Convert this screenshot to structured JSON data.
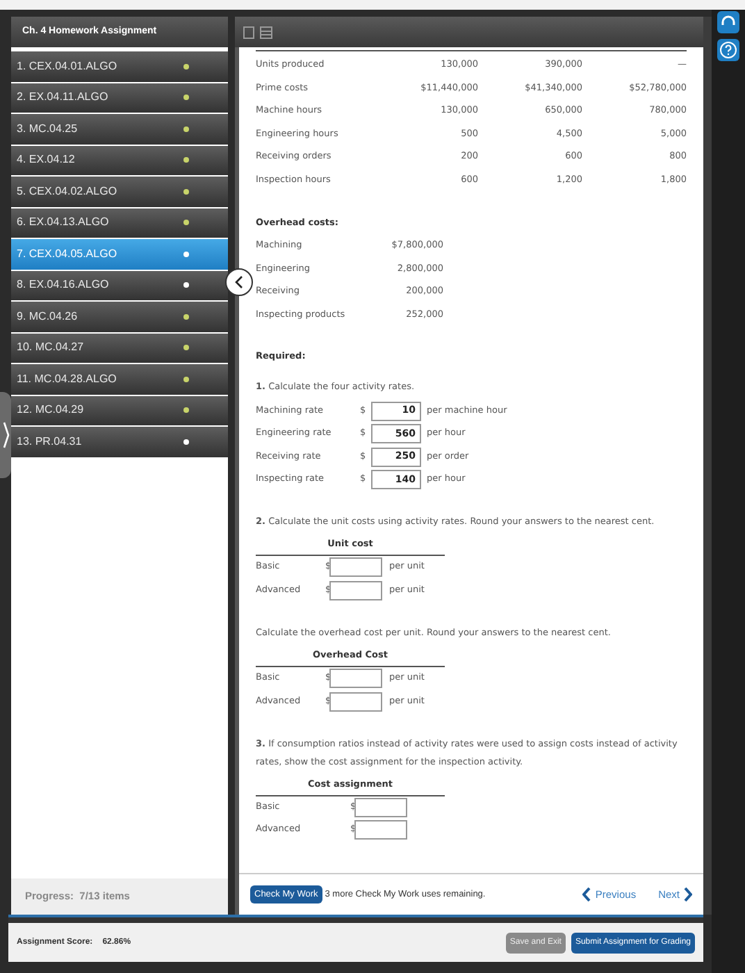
{
  "sidebar": {
    "title": "Ch. 4 Homework Assignment",
    "items": [
      {
        "label": "1. CEX.04.01.ALGO",
        "color": "#c8d46a",
        "selected": false
      },
      {
        "label": "2. EX.04.11.ALGO",
        "color": "#c8d46a",
        "selected": false
      },
      {
        "label": "3. MC.04.25",
        "color": "#c8d46a",
        "selected": false
      },
      {
        "label": "4. EX.04.12",
        "color": "#c8d46a",
        "selected": false
      },
      {
        "label": "5. CEX.04.02.ALGO",
        "color": "#c8d46a",
        "selected": false
      },
      {
        "label": "6. EX.04.13.ALGO",
        "color": "#c8d46a",
        "selected": false
      },
      {
        "label": "7. CEX.04.05.ALGO",
        "color": "#ffffff",
        "selected": true
      },
      {
        "label": "8. EX.04.16.ALGO",
        "color": "#ffffff",
        "selected": false
      },
      {
        "label": "9. MC.04.26",
        "color": "#c8d46a",
        "selected": false
      },
      {
        "label": "10. MC.04.27",
        "color": "#c8d46a",
        "selected": false
      },
      {
        "label": "11. MC.04.28.ALGO",
        "color": "#c8d46a",
        "selected": false
      },
      {
        "label": "12. MC.04.29",
        "color": "#c8d46a",
        "selected": false
      },
      {
        "label": "13. PR.04.31",
        "color": "#ffffff",
        "selected": false
      }
    ],
    "progress": "Progress:  7/13 items"
  },
  "data_table": {
    "rows": [
      {
        "label": "Units produced",
        "values": [
          "130,000",
          "390,000",
          "—"
        ]
      },
      {
        "label": "Prime costs",
        "values": [
          "$11,440,000",
          "$41,340,000",
          "$52,780,000"
        ]
      },
      {
        "label": "Machine hours",
        "values": [
          "130,000",
          "650,000",
          "780,000"
        ]
      },
      {
        "label": "Engineering hours",
        "values": [
          "500",
          "4,500",
          "5,000"
        ]
      },
      {
        "label": "Receiving orders",
        "values": [
          "200",
          "600",
          "800"
        ]
      },
      {
        "label": "Inspection hours",
        "values": [
          "600",
          "1,200",
          "1,800"
        ]
      }
    ]
  },
  "overhead": {
    "heading": "Overhead costs:",
    "rows": [
      {
        "label": "Machining",
        "value": "$7,800,000"
      },
      {
        "label": "Engineering",
        "value": "2,800,000"
      },
      {
        "label": "Receiving",
        "value": "200,000"
      },
      {
        "label": "Inspecting products",
        "value": "252,000"
      }
    ]
  },
  "required": {
    "heading": "Required:",
    "prompt": "**1.** Calculate the four activity rates.",
    "rows": [
      {
        "label": "Machining rate",
        "currency": "$",
        "value": "10",
        "unit": "per machine hour"
      },
      {
        "label": "Engineering rate",
        "currency": "$",
        "value": "560",
        "unit": "per hour"
      },
      {
        "label": "Receiving rate",
        "currency": "$",
        "value": "250",
        "unit": "per order"
      },
      {
        "label": "Inspecting rate",
        "currency": "$",
        "value": "140",
        "unit": "per hour"
      }
    ]
  },
  "tables": [
    {
      "prompt": "**2.** Calculate the unit costs using activity rates. Round your answers to the nearest cent.",
      "heading": "Unit cost",
      "rows": [
        {
          "label": "Basic",
          "currency": "$",
          "unit": "per unit"
        },
        {
          "label": "Advanced",
          "currency": "$",
          "unit": "per unit"
        }
      ]
    },
    {
      "prompt": "Calculate the overhead cost per unit. Round your answers to the nearest cent.",
      "heading": "Overhead Cost",
      "rows": [
        {
          "label": "Basic",
          "currency": "$",
          "unit": "per unit"
        },
        {
          "label": "Advanced",
          "currency": "$",
          "unit": "per unit"
        }
      ]
    },
    {
      "prompt": "**3.** If consumption ratios instead of activity rates were used to assign costs instead of activity rates, show the cost assignment for the inspection activity.",
      "heading": "Cost assignment",
      "rows": [
        {
          "label": "Basic",
          "currency": "$"
        },
        {
          "label": "Advanced",
          "currency": "$"
        }
      ]
    }
  ],
  "footer": {
    "check_button": "Check My Work",
    "remaining": "3 more Check My Work uses remaining.",
    "previous": "Previous",
    "next": "Next"
  },
  "bottom_bar": {
    "score_label": "Assignment Score:",
    "score": "62.86%",
    "save_button": "Save and Exit",
    "submit_button": "Submit Assignment for Grading"
  }
}
